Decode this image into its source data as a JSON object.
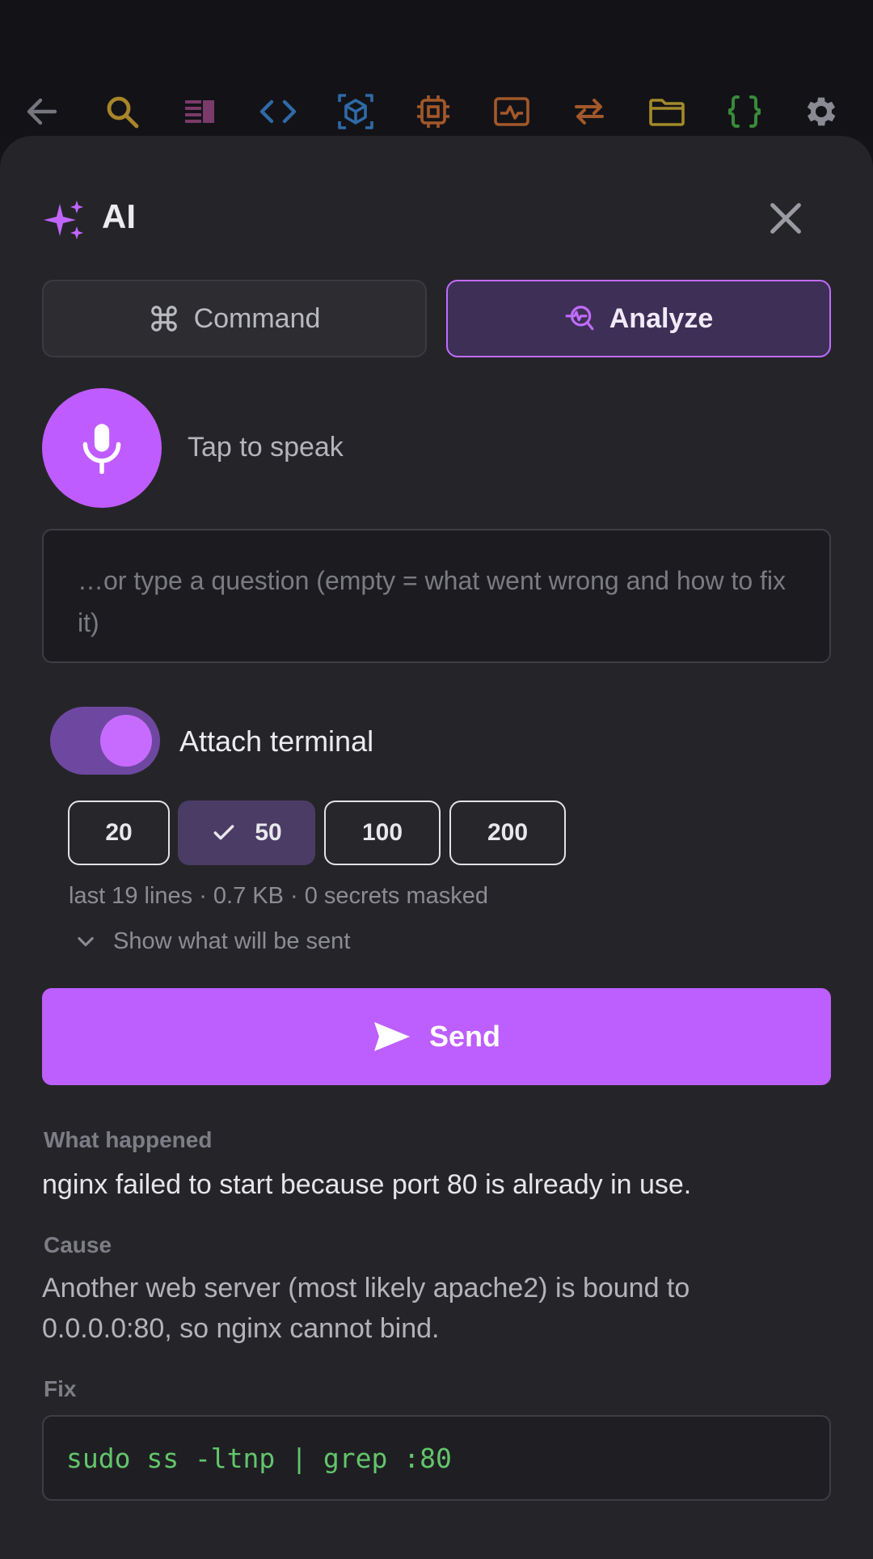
{
  "toolbar": {
    "icons": [
      {
        "name": "back-arrow-icon",
        "color": "#7a7a82"
      },
      {
        "name": "search-icon",
        "color": "#b08a2a"
      },
      {
        "name": "panels-icon",
        "color": "#7a3a6a"
      },
      {
        "name": "code-icon",
        "color": "#2f6aa6"
      },
      {
        "name": "cube-icon",
        "color": "#2f6aa6"
      },
      {
        "name": "cpu-icon",
        "color": "#a3582a"
      },
      {
        "name": "monitor-activity-icon",
        "color": "#a3582a"
      },
      {
        "name": "transfer-icon",
        "color": "#a3582a"
      },
      {
        "name": "folder-icon",
        "color": "#a38a2a"
      },
      {
        "name": "braces-icon",
        "color": "#3a8a3a"
      },
      {
        "name": "gear-icon",
        "color": "#8a8a92"
      }
    ]
  },
  "panel": {
    "title": "AI",
    "accent": "#bf5cff"
  },
  "modes": {
    "command_label": "Command",
    "analyze_label": "Analyze",
    "selected": "Analyze"
  },
  "voice": {
    "label": "Tap to speak"
  },
  "question": {
    "placeholder": "…or type a question (empty = what went wrong and how to fix it)",
    "value": ""
  },
  "attach": {
    "label": "Attach terminal",
    "enabled": true,
    "line_options": [
      "20",
      "50",
      "100",
      "200"
    ],
    "selected_option": "50",
    "meta": "last 19 lines · 0.7 KB · 0 secrets masked",
    "disclosure_label": "Show what will be sent"
  },
  "send": {
    "label": "Send"
  },
  "result": {
    "what_label": "What happened",
    "what_text": "nginx failed to start because port 80 is already in use.",
    "cause_label": "Cause",
    "cause_text": "Another web server (most likely apache2) is bound to 0.0.0.0:80, so nginx cannot bind.",
    "fix_label": "Fix",
    "fix_code": "sudo ss -ltnp | grep :80"
  }
}
